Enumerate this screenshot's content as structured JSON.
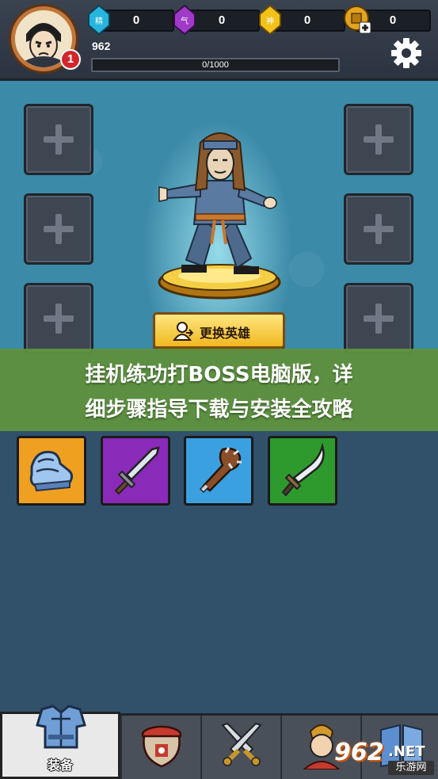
{
  "player": {
    "level": "1",
    "exp_value": "962",
    "exp_progress": "0/1000",
    "exp_fraction": 0.0
  },
  "resources": [
    {
      "name": "精",
      "value": "0",
      "color": "#2fb7e0",
      "icon": "cyan-gem-icon"
    },
    {
      "name": "气",
      "value": "0",
      "color": "#a23cc8",
      "icon": "purple-gem-icon"
    },
    {
      "name": "神",
      "value": "0",
      "color": "#f2c21c",
      "icon": "yellow-gem-icon"
    },
    {
      "name": "",
      "value": "0",
      "color": "#e0a020",
      "icon": "coin-add-icon"
    }
  ],
  "hero": {
    "change_button_label": "更换英雄"
  },
  "banner": {
    "line1": "挂机练功打BOSS电脑版，详",
    "line2": "细步骤指导下载与安装全攻略"
  },
  "equipment": [
    {
      "icon": "boots-icon",
      "rarity_color": "#f0a020"
    },
    {
      "icon": "sword-icon",
      "rarity_color": "#8a2ab8"
    },
    {
      "icon": "club-icon",
      "rarity_color": "#3aa0e0"
    },
    {
      "icon": "sabre-icon",
      "rarity_color": "#2e9a2e"
    }
  ],
  "nav": {
    "items": [
      {
        "label": "装备",
        "icon": "armor-icon"
      },
      {
        "label": "",
        "icon": "wine-jar-icon"
      },
      {
        "label": "",
        "icon": "crossed-swords-icon"
      },
      {
        "label": "",
        "icon": "character-icon"
      },
      {
        "label": "",
        "icon": "book-icon"
      }
    ]
  },
  "watermark": {
    "number": "962",
    "net": ".NET",
    "site": "乐游网"
  }
}
